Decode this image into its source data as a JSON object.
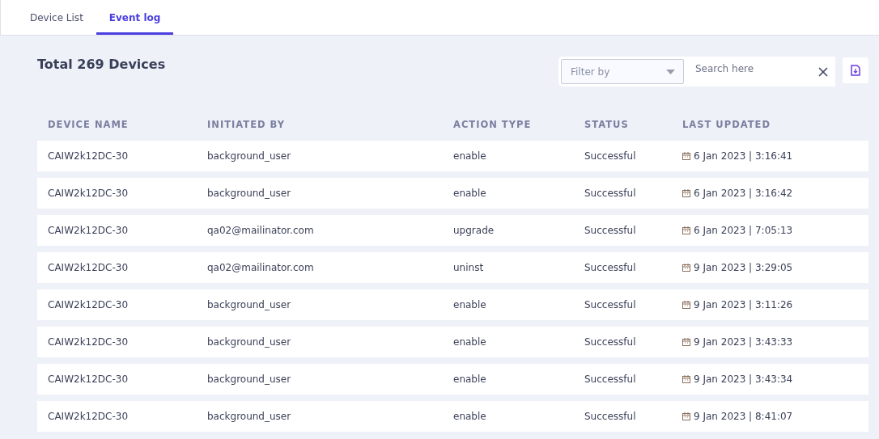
{
  "tabs": [
    {
      "label": "Device List",
      "selected": false
    },
    {
      "label": "Event log",
      "selected": true
    }
  ],
  "title": "Total 269 Devices",
  "filter": {
    "placeholder": "Filter by"
  },
  "search": {
    "placeholder": "Search here"
  },
  "table": {
    "columns": [
      "DEVICE NAME",
      "INITIATED BY",
      "ACTION TYPE",
      "STATUS",
      "LAST UPDATED"
    ],
    "rows": [
      [
        "CAIW2k12DC-30",
        "background_user",
        "enable",
        "Successful",
        "6 Jan 2023 | 3:16:41"
      ],
      [
        "CAIW2k12DC-30",
        "background_user",
        "enable",
        "Successful",
        "6 Jan 2023 | 3:16:42"
      ],
      [
        "CAIW2k12DC-30",
        "qa02@mailinator.com",
        "upgrade",
        "Successful",
        "6 Jan 2023 | 7:05:13"
      ],
      [
        "CAIW2k12DC-30",
        "qa02@mailinator.com",
        "uninst",
        "Successful",
        "9 Jan 2023 | 3:29:05"
      ],
      [
        "CAIW2k12DC-30",
        "background_user",
        "enable",
        "Successful",
        "9 Jan 2023 | 3:11:26"
      ],
      [
        "CAIW2k12DC-30",
        "background_user",
        "enable",
        "Successful",
        "9 Jan 2023 | 3:43:33"
      ],
      [
        "CAIW2k12DC-30",
        "background_user",
        "enable",
        "Successful",
        "9 Jan 2023 | 3:43:34"
      ],
      [
        "CAIW2k12DC-30",
        "background_user",
        "enable",
        "Successful",
        "9 Jan 2023 | 8:41:07"
      ]
    ]
  }
}
